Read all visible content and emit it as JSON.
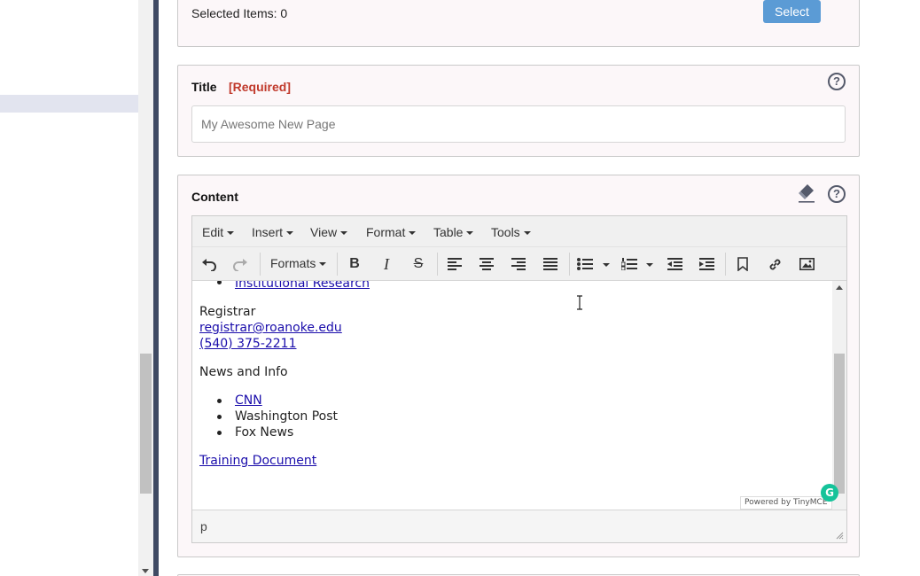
{
  "select_panel": {
    "selected_label": "Selected Items: 0",
    "select_button": "Select"
  },
  "title_field": {
    "label": "Title",
    "required": "[Required]",
    "help": "?",
    "placeholder": "My Awesome New Page"
  },
  "content_field": {
    "label": "Content",
    "help": "?"
  },
  "editor": {
    "menus": [
      "Edit",
      "Insert",
      "View",
      "Format",
      "Table",
      "Tools"
    ],
    "toolbar": {
      "formats_label": "Formats",
      "bold": "B",
      "italic": "I",
      "strike": "S"
    },
    "body": {
      "list_link_top": "Institutional Research",
      "registrar_heading": "Registrar",
      "registrar_email": "registrar@roanoke.edu",
      "registrar_phone": "(540) 375-2211",
      "news_heading": "News and Info",
      "news_items": [
        "CNN",
        "Washington Post",
        "Fox News"
      ],
      "training_link": "Training Document"
    },
    "powered_by": "Powered by TinyMCE",
    "grammarly": "G",
    "status_path": "p"
  },
  "colors": {
    "select_button": "#5b9bd5",
    "required": "#c0392b",
    "divider": "#3f4a63",
    "link": "#1a0dab"
  },
  "icons": [
    "question-circle-icon",
    "eraser-icon",
    "undo-icon",
    "redo-icon",
    "bold-icon",
    "italic-icon",
    "strikethrough-icon",
    "align-left-icon",
    "align-center-icon",
    "align-right-icon",
    "align-justify-icon",
    "bullet-list-icon",
    "numbered-list-icon",
    "outdent-icon",
    "indent-icon",
    "bookmark-icon",
    "link-icon",
    "image-icon"
  ]
}
